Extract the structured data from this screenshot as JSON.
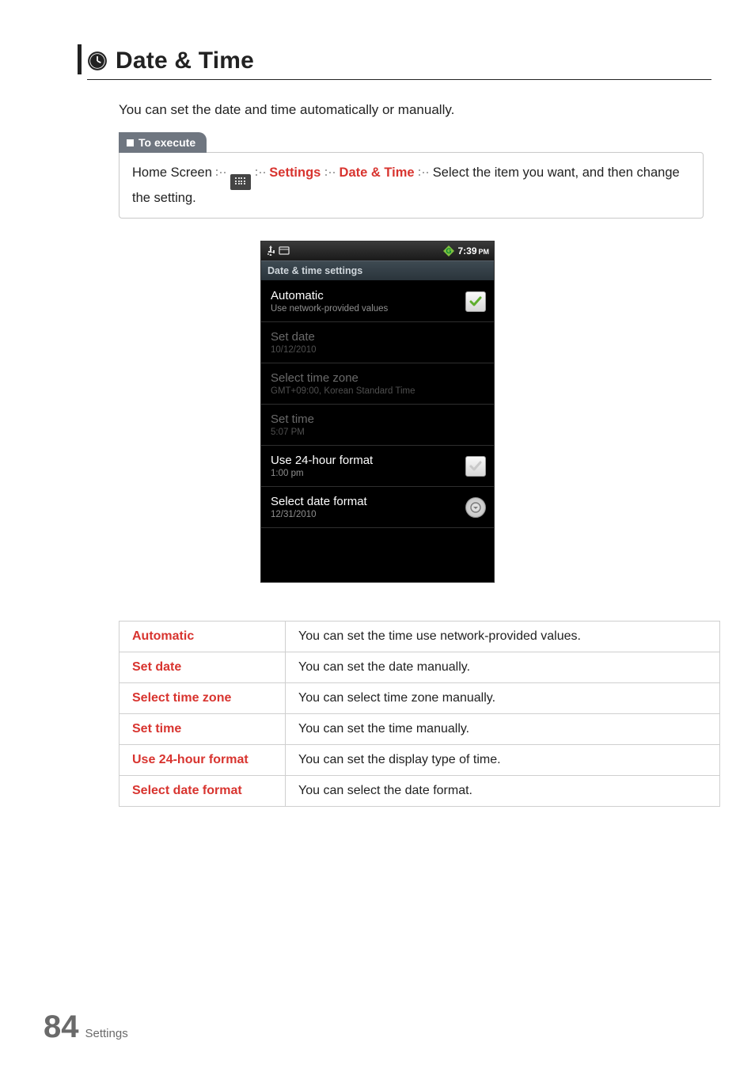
{
  "page": {
    "title": "Date & Time",
    "intro": "You can set the date and time automatically or manually.",
    "number": "84",
    "section": "Settings"
  },
  "exec": {
    "tab_label": "To execute",
    "crumb_home": "Home Screen",
    "crumb_settings": "Settings",
    "crumb_datetime": "Date & Time",
    "tail": "Select the item you want, and then change the setting."
  },
  "phone": {
    "status_time": "7:39",
    "status_ampm": "PM",
    "screen_title": "Date & time settings",
    "rows": {
      "automatic": {
        "title": "Automatic",
        "sub": "Use network-provided values"
      },
      "set_date": {
        "title": "Set date",
        "sub": "10/12/2010"
      },
      "select_tz": {
        "title": "Select time zone",
        "sub": "GMT+09:00, Korean Standard Time"
      },
      "set_time": {
        "title": "Set time",
        "sub": "5:07 PM"
      },
      "use_24h": {
        "title": "Use 24-hour format",
        "sub": "1:00 pm"
      },
      "select_df": {
        "title": "Select date format",
        "sub": "12/31/2010"
      }
    }
  },
  "table": {
    "r1": {
      "k": "Automatic",
      "v": "You can set the time use network-provided values."
    },
    "r2": {
      "k": "Set date",
      "v": "You can set the date manually."
    },
    "r3": {
      "k": "Select time zone",
      "v": "You can select time zone  manually."
    },
    "r4": {
      "k": "Set time",
      "v": "You can set the time manually."
    },
    "r5": {
      "k": "Use 24-hour format",
      "v": "You can set the display type of time."
    },
    "r6": {
      "k": "Select date format",
      "v": "You can select the date format."
    }
  }
}
